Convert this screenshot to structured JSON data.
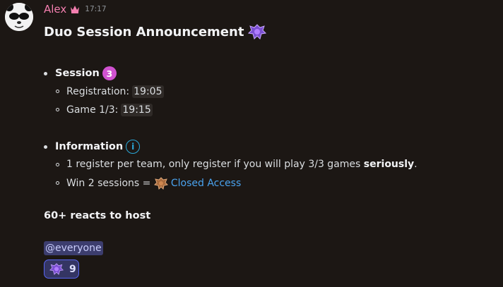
{
  "message": {
    "author": "Alex",
    "author_badge_icon": "crown-icon",
    "timestamp": "17:17",
    "title": "Duo Session Announcement",
    "title_emoji": "purple-emblem-emoji"
  },
  "session": {
    "label": "Session",
    "number": "3",
    "items": [
      {
        "label": "Registration:",
        "time": "19:05"
      },
      {
        "label": "Game 1/3:",
        "time": "19:15"
      }
    ]
  },
  "information": {
    "label": "Information",
    "icon": "info-icon",
    "line1_prefix": "1 register per team, only register if you will play 3/3 games",
    "line1_bold": "seriously",
    "line1_suffix": ".",
    "line2_prefix": "Win 2 sessions =",
    "line2_emoji": "bronze-emblem-emoji",
    "line2_link": "Closed Access"
  },
  "footer": {
    "reacts_text": "60+ reacts to host",
    "mention": "@everyone"
  },
  "reaction": {
    "emoji": "purple-emblem-emoji",
    "count": "9"
  },
  "colors": {
    "background": "#1c1714",
    "author": "#f47fb0",
    "link": "#4aa3ef",
    "mention_bg": "#3c3d6e",
    "reaction_border": "#5865f2",
    "badge": "#d052d0",
    "info": "#2aa8d9"
  }
}
